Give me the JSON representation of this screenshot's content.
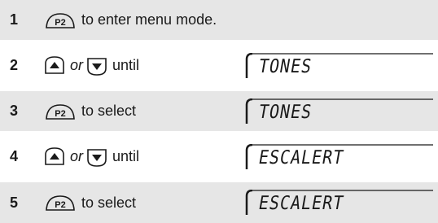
{
  "steps": [
    {
      "number": "1",
      "key": "P2",
      "arrows": false,
      "text": "to enter menu mode.",
      "display": ""
    },
    {
      "number": "2",
      "key": "",
      "arrows": true,
      "or": "or",
      "text": "until",
      "display": "TONES"
    },
    {
      "number": "3",
      "key": "P2",
      "arrows": false,
      "text": "to select",
      "display": "TONES"
    },
    {
      "number": "4",
      "key": "",
      "arrows": true,
      "or": "or",
      "text": "until",
      "display": "ESCALERT"
    },
    {
      "number": "5",
      "key": "P2",
      "arrows": false,
      "text": "to select",
      "display": "ESCALERT"
    }
  ],
  "colors": {
    "shaded_row": "#e6e6e6",
    "ink": "#1a1a1a"
  },
  "icons": {
    "programmable": "p2-button-icon",
    "up": "up-arrow-icon",
    "down": "down-arrow-icon"
  }
}
